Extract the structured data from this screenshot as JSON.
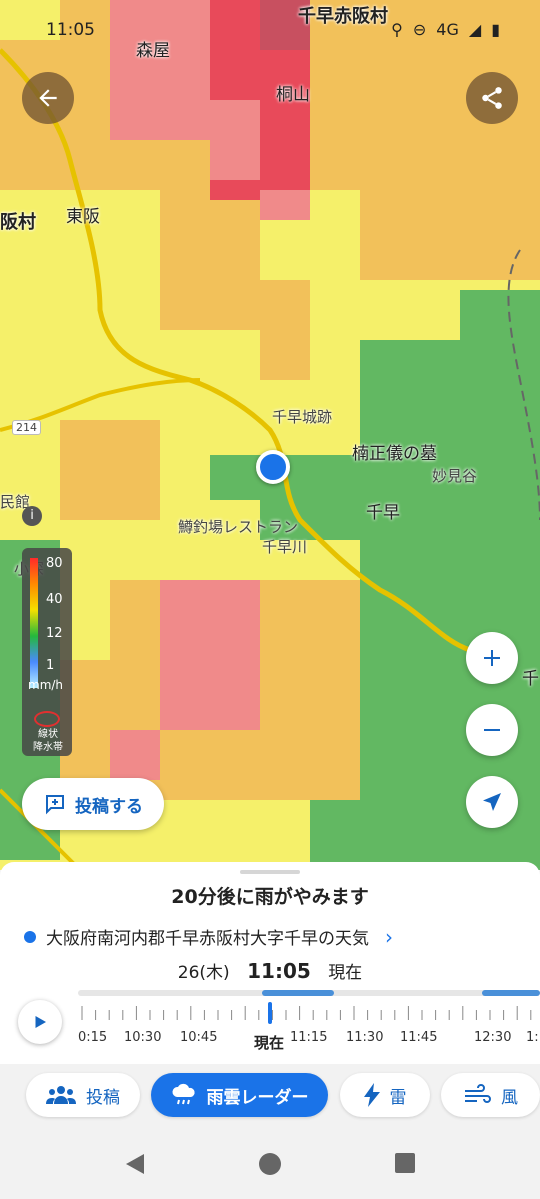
{
  "status_bar": {
    "time": "11:05",
    "network": "4G"
  },
  "map": {
    "place_labels": [
      {
        "key": "chihaya_akasaka_top",
        "text": "千早赤阪村"
      },
      {
        "key": "moriya",
        "text": "森屋"
      },
      {
        "key": "kiriyama",
        "text": "桐山"
      },
      {
        "key": "higashisaka",
        "text": "東阪"
      },
      {
        "key": "akasaka_mura",
        "text": "阪村"
      },
      {
        "key": "chihaya_castle",
        "text": "千早城跡"
      },
      {
        "key": "kusunoki_tomb",
        "text": "楠正儀の墓"
      },
      {
        "key": "myokendani",
        "text": "妙見谷"
      },
      {
        "key": "chihaya",
        "text": "千早"
      },
      {
        "key": "restaurant",
        "text": "鱒釣場レストラン"
      },
      {
        "key": "chihaya_river",
        "text": "千早川"
      },
      {
        "key": "kan",
        "text": "民館"
      },
      {
        "key": "route_214",
        "text": "214"
      },
      {
        "key": "ko",
        "text": "小深"
      },
      {
        "key": "right_edge",
        "text": "千"
      }
    ]
  },
  "legend": {
    "ticks": [
      "80",
      "40",
      "12",
      "1"
    ],
    "unit": "mm/h",
    "band_note_line1": "線状",
    "band_note_line2": "降水帯",
    "colors": [
      "#ff2a2a",
      "#ff8a00",
      "#f5e000",
      "#24b83c",
      "#4a8aff",
      "#b8f0ff"
    ]
  },
  "buttons": {
    "post_label": "投稿する"
  },
  "sheet": {
    "headline": "20分後に雨がやみます",
    "location": "大阪府南河内郡千早赤阪村大字千早の天気",
    "date": "26(木)",
    "time": "11:05",
    "time_suffix": "現在"
  },
  "timeline": {
    "labels": [
      "0:15",
      "10:30",
      "10:45",
      "11:15",
      "11:30",
      "11:45",
      "12:30",
      "1:"
    ],
    "now_label": "現在"
  },
  "tabs": [
    {
      "label": "投稿",
      "icon": "people-icon"
    },
    {
      "label": "雨雲レーダー",
      "icon": "rain-cloud-icon",
      "active": true
    },
    {
      "label": "雷",
      "icon": "lightning-icon"
    },
    {
      "label": "風",
      "icon": "wind-icon"
    }
  ],
  "colors": {
    "accent": "#1a73e8",
    "rain_light": "#f5f06a",
    "rain_moderate": "#f2c15a",
    "rain_heavy": "#f08a8a",
    "rain_very_heavy": "#e84a5a",
    "no_rain_green": "#62b862"
  }
}
